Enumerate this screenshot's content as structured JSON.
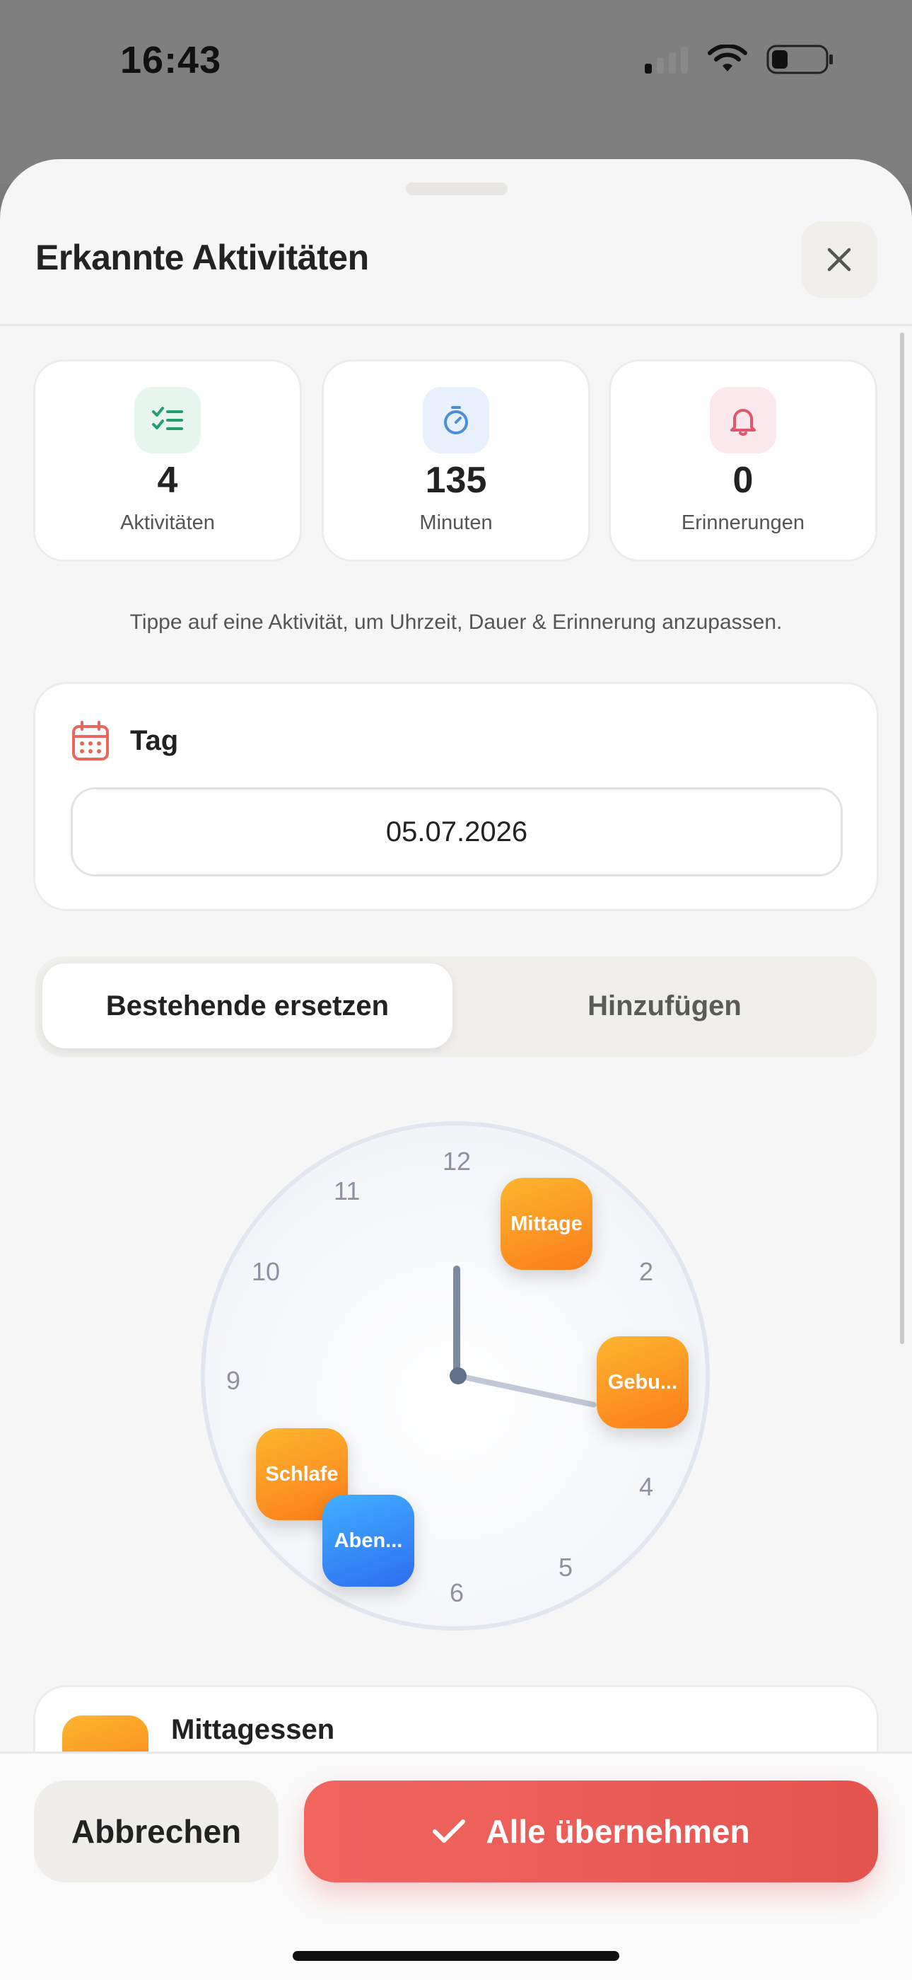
{
  "status_bar": {
    "time": "16:43"
  },
  "sheet": {
    "title": "Erkannte Aktivitäten",
    "stats": [
      {
        "value": "4",
        "label": "Aktivitäten",
        "icon": "checklist-icon",
        "icon_color": "#22a06b",
        "icon_bg": "#e6f6ef"
      },
      {
        "value": "135",
        "label": "Minuten",
        "icon": "stopwatch-icon",
        "icon_color": "#4a8fd8",
        "icon_bg": "#e8f0fb"
      },
      {
        "value": "0",
        "label": "Erinnerungen",
        "icon": "bell-icon",
        "icon_color": "#e2566b",
        "icon_bg": "#fbe8ec"
      }
    ],
    "hint": "Tippe auf eine Aktivität, um Uhrzeit, Dauer & Erinnerung anzupassen.",
    "day": {
      "label": "Tag",
      "date": "05.07.2026"
    },
    "mode": {
      "replace": "Bestehende ersetzen",
      "add": "Hinzufügen",
      "selected": "replace"
    },
    "clock": {
      "numbers": [
        "12",
        "11",
        "10",
        "9",
        "2",
        "4",
        "5",
        "6"
      ],
      "activities": [
        {
          "label": "Mittage",
          "color": "orange"
        },
        {
          "label": "Gebu...",
          "color": "orange"
        },
        {
          "label": "Schlafe",
          "color": "orange"
        },
        {
          "label": "Aben...",
          "color": "blue"
        }
      ]
    },
    "list": [
      {
        "title": "Mittagessen"
      }
    ],
    "actions": {
      "cancel": "Abbrechen",
      "accept": "Alle übernehmen"
    }
  },
  "colors": {
    "accent": "#e85a54",
    "activity_orange": "#fb8c1f",
    "activity_blue": "#2f7cf6"
  }
}
